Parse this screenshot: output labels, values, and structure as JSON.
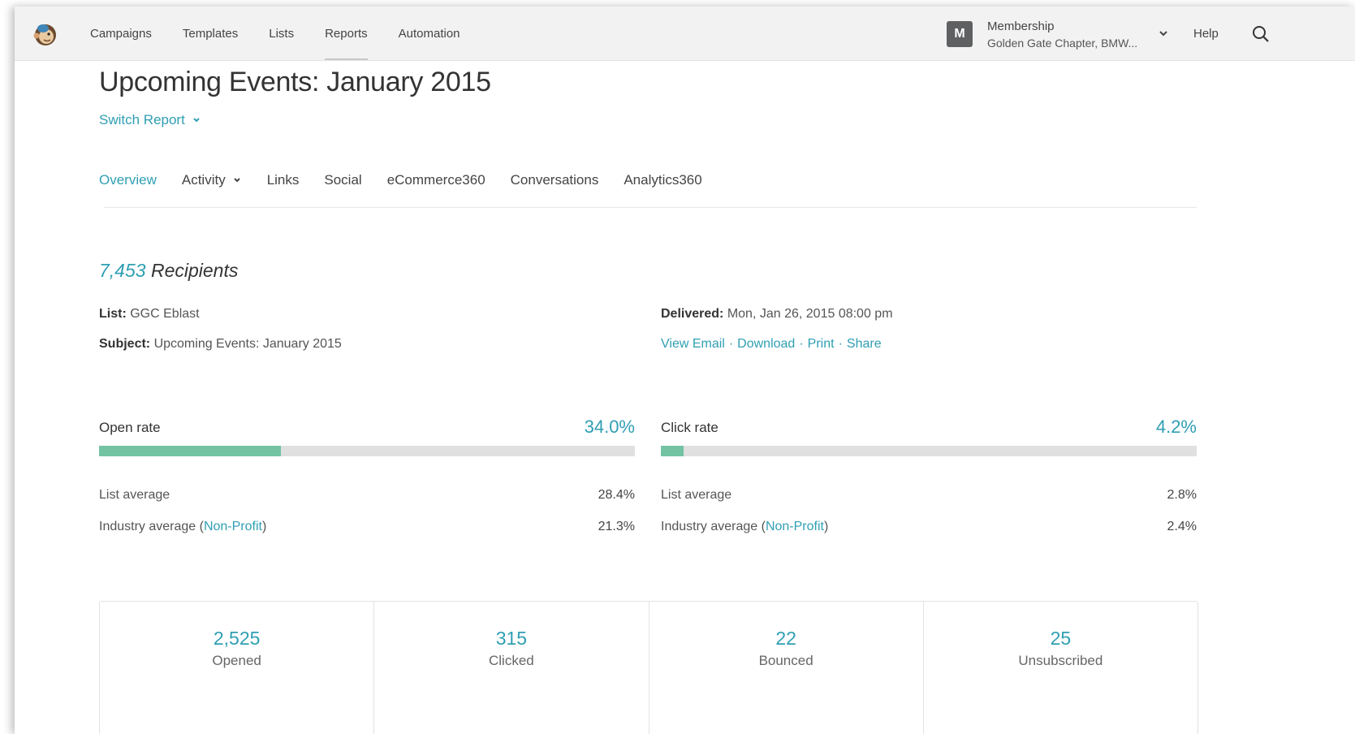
{
  "nav": {
    "items": [
      {
        "label": "Campaigns"
      },
      {
        "label": "Templates"
      },
      {
        "label": "Lists"
      },
      {
        "label": "Reports",
        "active": true
      },
      {
        "label": "Automation"
      }
    ],
    "account": {
      "initial": "M",
      "name": "Membership",
      "org": "Golden Gate Chapter, BMW..."
    },
    "help": "Help"
  },
  "report": {
    "title": "Upcoming Events: January 2015",
    "switch_label": "Switch Report"
  },
  "tabs": [
    {
      "label": "Overview",
      "active": true
    },
    {
      "label": "Activity",
      "dropdown": true
    },
    {
      "label": "Links"
    },
    {
      "label": "Social"
    },
    {
      "label": "eCommerce360"
    },
    {
      "label": "Conversations"
    },
    {
      "label": "Analytics360"
    }
  ],
  "summary": {
    "recipients_count": "7,453",
    "recipients_label": "Recipients",
    "list_label": "List:",
    "list_value": "GGC Eblast",
    "subject_label": "Subject:",
    "subject_value": "Upcoming Events: January 2015",
    "delivered_label": "Delivered:",
    "delivered_value": "Mon, Jan 26, 2015 08:00 pm",
    "links": [
      "View Email",
      "Download",
      "Print",
      "Share"
    ]
  },
  "open_rate": {
    "label": "Open rate",
    "value": "34.0%",
    "fraction": 0.34,
    "list_avg_label": "List average",
    "list_avg": "28.4%",
    "industry_label": "Industry average (",
    "industry_link": "Non-Profit",
    "industry_close": ")",
    "industry_avg": "21.3%"
  },
  "click_rate": {
    "label": "Click rate",
    "value": "4.2%",
    "fraction": 0.042,
    "list_avg_label": "List average",
    "list_avg": "2.8%",
    "industry_label": "Industry average (",
    "industry_link": "Non-Profit",
    "industry_close": ")",
    "industry_avg": "2.4%"
  },
  "stats": [
    {
      "value": "2,525",
      "label": "Opened"
    },
    {
      "value": "315",
      "label": "Clicked"
    },
    {
      "value": "22",
      "label": "Bounced"
    },
    {
      "value": "25",
      "label": "Unsubscribed"
    }
  ],
  "colors": {
    "accent": "#2f9fb3",
    "bar_fill": "#73c3a3",
    "bar_track": "#e0e0e0"
  }
}
